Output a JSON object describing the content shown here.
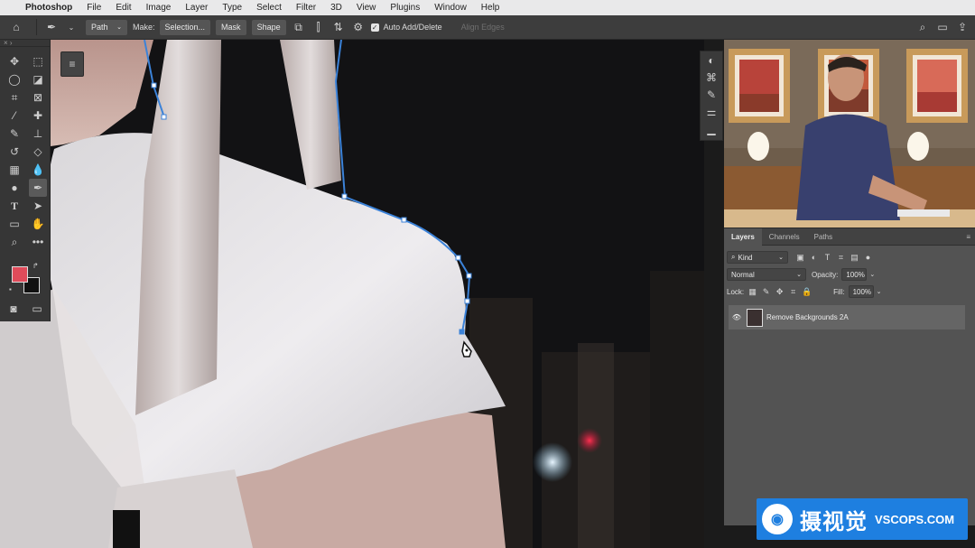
{
  "menubar": {
    "app": "Photoshop",
    "items": [
      "File",
      "Edit",
      "Image",
      "Layer",
      "Type",
      "Select",
      "Filter",
      "3D",
      "View",
      "Plugins",
      "Window",
      "Help"
    ]
  },
  "options": {
    "mode": "Path",
    "make_label": "Make:",
    "selection_btn": "Selection...",
    "mask_btn": "Mask",
    "shape_btn": "Shape",
    "auto_add_delete": "Auto Add/Delete",
    "align_edges": "Align Edges"
  },
  "swatches": {
    "foreground": "#e04b5a",
    "background": "#111111"
  },
  "layers_panel": {
    "tabs": [
      "Layers",
      "Channels",
      "Paths"
    ],
    "filter_kind": "Kind",
    "blend_mode": "Normal",
    "opacity_label": "Opacity:",
    "opacity_value": "100%",
    "lock_label": "Lock:",
    "fill_label": "Fill:",
    "fill_value": "100%",
    "layer_name": "Remove Backgrounds 2A"
  },
  "watermark": {
    "chinese": "摄视觉",
    "english": "VSCOPS.COM"
  }
}
